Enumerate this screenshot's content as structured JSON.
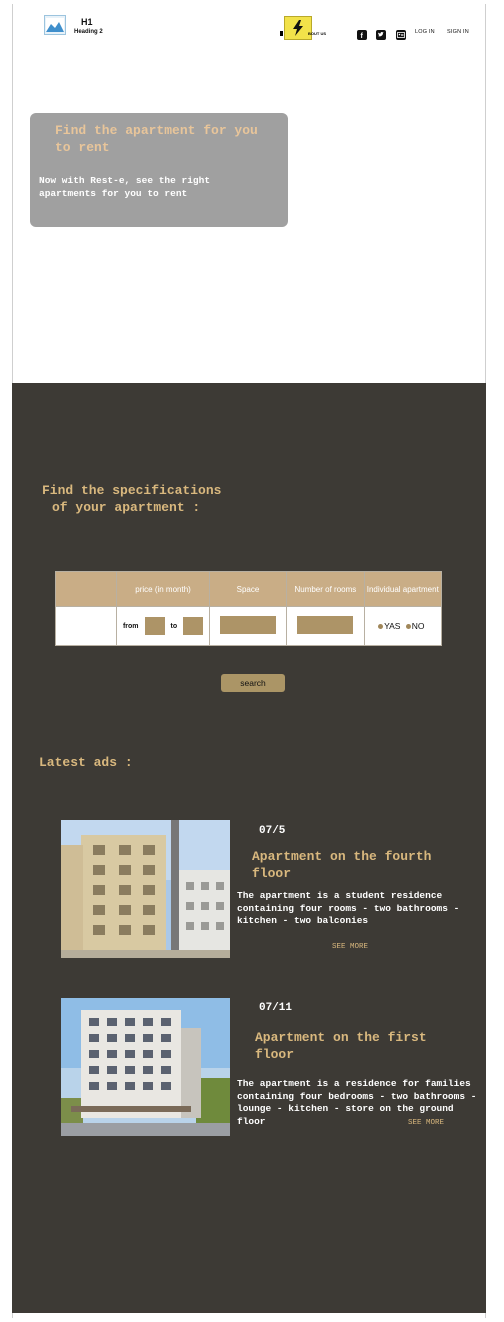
{
  "header": {
    "logo_title": "H1",
    "logo_subtitle": "Heading 2",
    "nav_about": "BOUT US",
    "nav_login": "LOG IN",
    "nav_signin": "SIGN IN",
    "icons": [
      "facebook-icon",
      "twitter-icon",
      "contact-card-icon"
    ]
  },
  "hero": {
    "title": "Find the apartment for you to rent",
    "subtitle": "Now with Rest-e, see the right apartments for you to rent"
  },
  "specs": {
    "title_line1": "Find the specifications",
    "title_line2": "of your apartment :",
    "columns": [
      "price (in month)",
      "Space",
      "Number of rooms",
      "Individual apartment"
    ],
    "from_label": "from",
    "to_label": "to",
    "yes_label": "YAS",
    "no_label": "NO",
    "search_label": "search"
  },
  "latest": {
    "title": "Latest ads :",
    "ads": [
      {
        "date": "07/5",
        "title": "Apartment on the fourth floor",
        "description": "The apartment is a student residence containing four rooms - two bathrooms - kitchen - two balconies",
        "see_more": "SEE MORE"
      },
      {
        "date": "07/11",
        "title": "Apartment on the first floor",
        "description": "The apartment is a residence for families containing four bedrooms - two bathrooms - lounge - kitchen - store on the ground floor",
        "see_more": "SEE MORE"
      }
    ]
  },
  "colors": {
    "dark_bg": "#3d3a35",
    "accent_gold": "#d9b87e",
    "table_header": "#c9ad86",
    "input_fill": "#ad9467",
    "hero_box": "#a0a0a0"
  }
}
